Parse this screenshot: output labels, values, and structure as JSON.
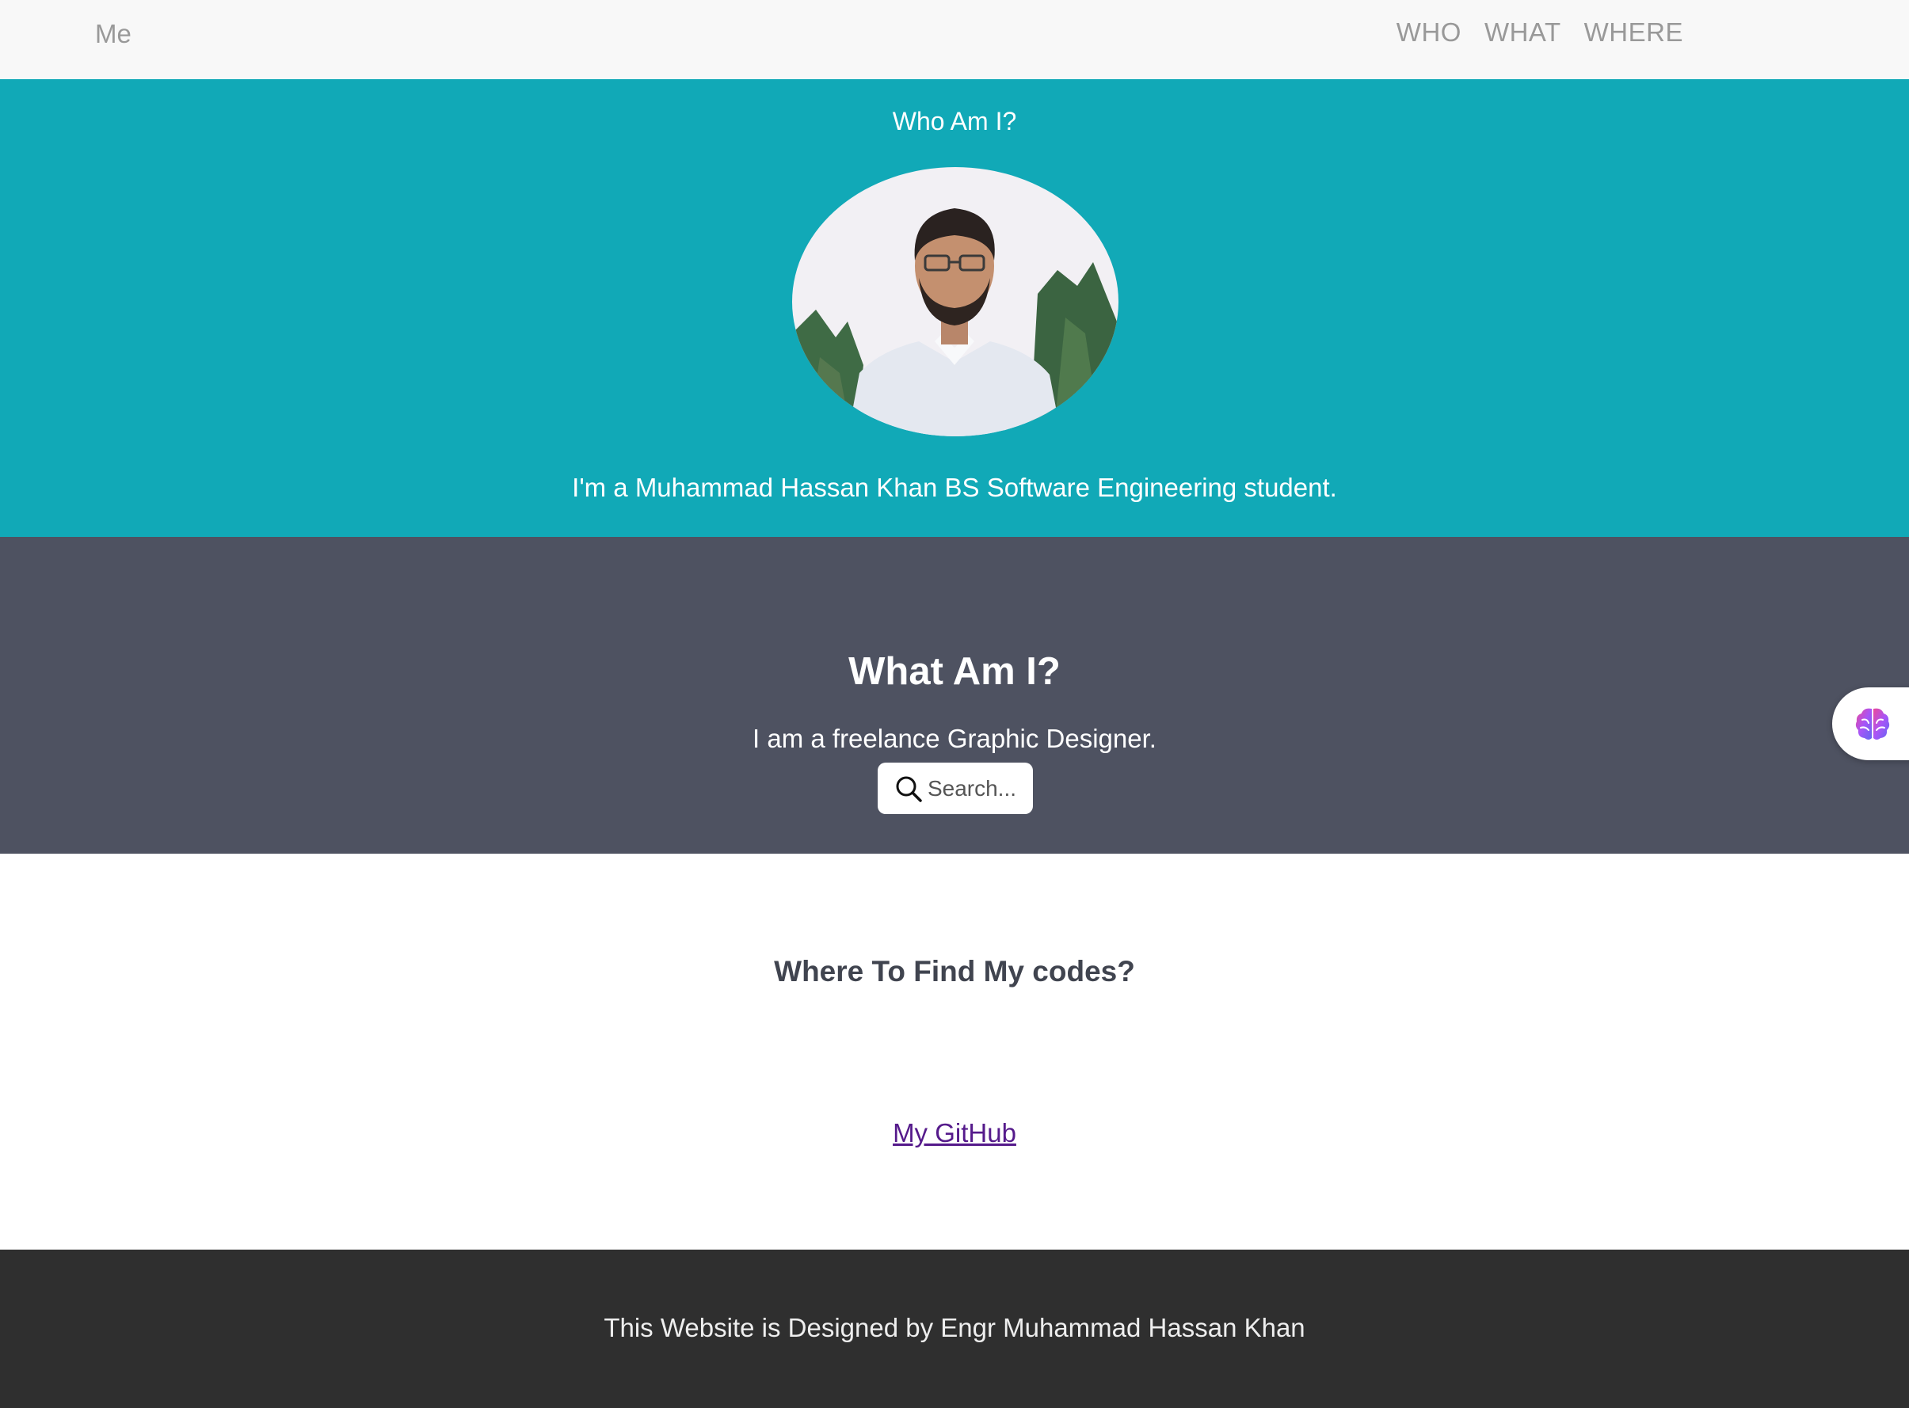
{
  "nav": {
    "brand": "Me",
    "links": [
      "WHO",
      "WHAT",
      "WHERE"
    ]
  },
  "who": {
    "title": "Who Am I?",
    "description": "I'm a Muhammad Hassan Khan BS Software Engineering student."
  },
  "what": {
    "title": "What Am I?",
    "description": "I am a freelance Graphic Designer.",
    "search_label": "Search..."
  },
  "where": {
    "title": "Where To Find My codes?",
    "link_text": "My GitHub"
  },
  "footer": {
    "text": "This Website is Designed by Engr Muhammad Hassan Khan"
  },
  "colors": {
    "navbar_bg": "#f8f8f8",
    "who_bg": "#11a9b7",
    "what_bg": "#4e5261",
    "footer_bg": "#2f2f2f",
    "link": "#551a8b"
  },
  "icons": {
    "search": "magnifier-icon",
    "widget": "brain-icon"
  }
}
